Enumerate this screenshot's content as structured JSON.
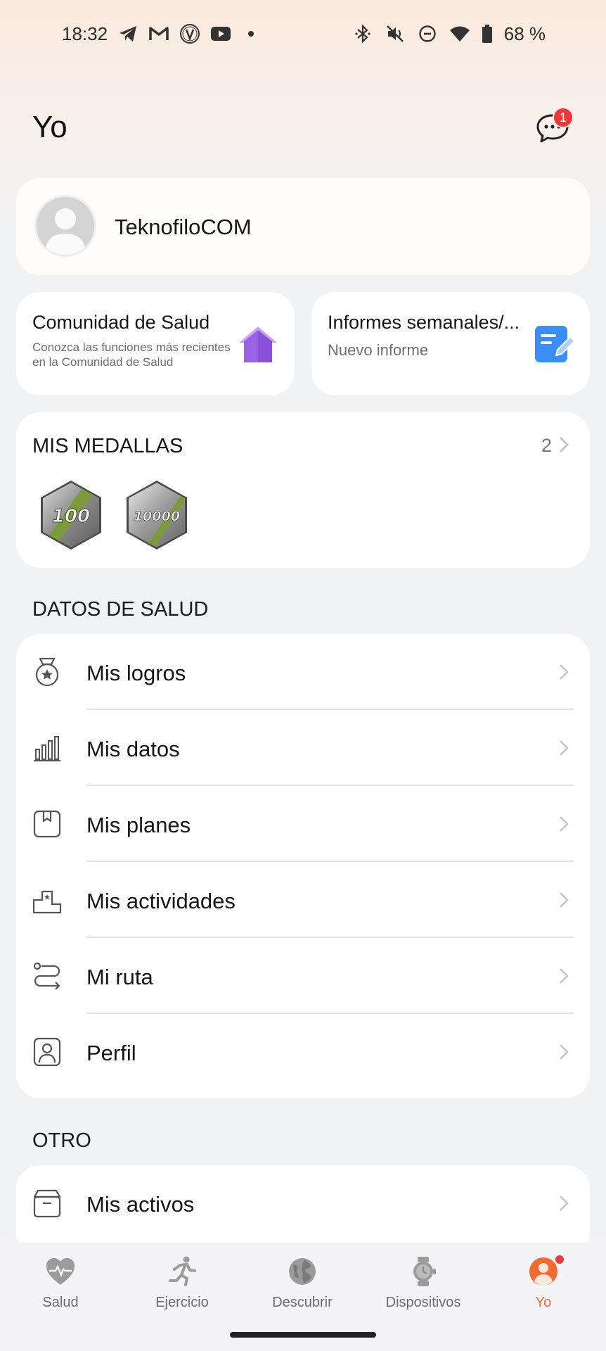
{
  "status_bar": {
    "time": "18:32",
    "left_icons": [
      "telegram-icon",
      "gmail-icon",
      "v-app-icon",
      "youtube-icon",
      "dot-icon"
    ],
    "right_icons": [
      "bluetooth-icon",
      "mute-icon",
      "dnd-icon",
      "wifi-icon",
      "battery-icon"
    ],
    "battery": "68 %"
  },
  "header": {
    "title": "Yo",
    "messages_badge": "1"
  },
  "profile": {
    "name": "TeknofiloCOM"
  },
  "shortcuts": [
    {
      "title": "Comunidad de Salud",
      "subtitle": "Conozca las funciones más recientes en la Comunidad de Salud",
      "icon": "house-icon"
    },
    {
      "title": "Informes semanales/...",
      "subtitle": "Nuevo informe",
      "icon": "report-icon"
    }
  ],
  "medals": {
    "title": "MIS MEDALLAS",
    "count": "2",
    "items": [
      {
        "label": "100"
      },
      {
        "label": "10000"
      }
    ]
  },
  "health_section": {
    "title": "DATOS DE SALUD",
    "items": [
      {
        "label": "Mis logros",
        "icon": "medal-icon"
      },
      {
        "label": "Mis datos",
        "icon": "bar-chart-icon"
      },
      {
        "label": "Mis planes",
        "icon": "bookmark-icon"
      },
      {
        "label": "Mis actividades",
        "icon": "podium-icon"
      },
      {
        "label": "Mi ruta",
        "icon": "route-icon"
      },
      {
        "label": "Perfil",
        "icon": "profile-icon"
      }
    ]
  },
  "other_section": {
    "title": "OTRO",
    "items": [
      {
        "label": "Mis activos",
        "icon": "box-icon"
      }
    ]
  },
  "bottom_nav": {
    "items": [
      {
        "label": "Salud",
        "icon": "heart-icon"
      },
      {
        "label": "Ejercicio",
        "icon": "running-icon"
      },
      {
        "label": "Descubrir",
        "icon": "globe-icon"
      },
      {
        "label": "Dispositivos",
        "icon": "watch-icon"
      },
      {
        "label": "Yo",
        "icon": "user-icon",
        "active": true
      }
    ]
  },
  "colors": {
    "accent": "#ef6b33",
    "badge": "#e83a3a",
    "background": "#f1f2f4"
  }
}
